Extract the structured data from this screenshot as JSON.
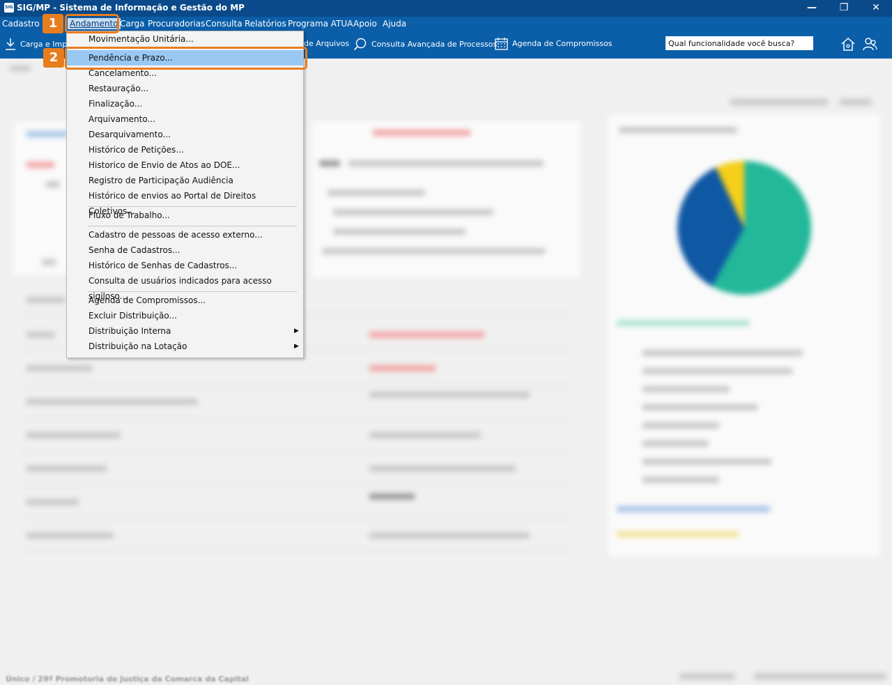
{
  "window": {
    "title": "SIG/MP - Sistema de Informação e Gestão do MP",
    "logo_text": "SIG"
  },
  "menubar": [
    {
      "label": "Cadastro"
    },
    {
      "label": "Andamento",
      "active": true
    },
    {
      "label": "Carga"
    },
    {
      "label": "Procuradorias"
    },
    {
      "label": "Consulta"
    },
    {
      "label": "Relatórios"
    },
    {
      "label": "Programa ATUA"
    },
    {
      "label": "Apoio"
    },
    {
      "label": "Ajuda"
    }
  ],
  "toolbar": {
    "carga_label": "Carga e Impo",
    "arquivos_label": "de Arquivos",
    "consulta_label": "Consulta Avançada de Processos",
    "agenda_label": "Agenda de Compromissos",
    "search_placeholder": "Qual funcionalidade você busca?"
  },
  "dropdown": {
    "items": [
      {
        "label": "Movimentação Unitária..."
      },
      {
        "label": "Pendência e Prazo...",
        "highlighted": true
      },
      {
        "label": "Cancelamento..."
      },
      {
        "label": "Restauração..."
      },
      {
        "label": "Finalização..."
      },
      {
        "label": "Arquivamento..."
      },
      {
        "label": "Desarquivamento..."
      },
      {
        "label": "Histórico de Petições..."
      },
      {
        "label": "Historico de Envio de Atos ao DOE..."
      },
      {
        "label": "Registro de Participação Audiência"
      },
      {
        "label": "Histórico de envios ao Portal de Direitos Coletivos..."
      },
      {
        "label": "Fluxo de Trabalho..."
      },
      {
        "label": "Cadastro de pessoas de acesso externo..."
      },
      {
        "label": "Senha de Cadastros..."
      },
      {
        "label": "Histórico de Senhas de Cadastros..."
      },
      {
        "label": "Consulta de usuários indicados para acesso sigiloso..."
      },
      {
        "label": "Agenda de Compromissos..."
      },
      {
        "label": "Excluir Distribuição..."
      },
      {
        "label": "Distribuição Interna",
        "submenu": true
      },
      {
        "label": "Distribuição na Lotação",
        "submenu": true
      }
    ]
  },
  "callouts": {
    "one": "1",
    "two": "2"
  },
  "footer": {
    "text": "Único / 29ª Promotoria de Justiça da Comarca da Capital"
  },
  "chart_data": {
    "type": "pie",
    "values": [
      0.58,
      0.35,
      0.07
    ],
    "colors": [
      "#22b899",
      "#0e58a4",
      "#f5cf1a"
    ]
  },
  "colors": {
    "titlebar": "#0a4a8a",
    "menubar": "#0b5ea8",
    "accent": "#e87d1e",
    "highlight": "#99c9f3"
  }
}
